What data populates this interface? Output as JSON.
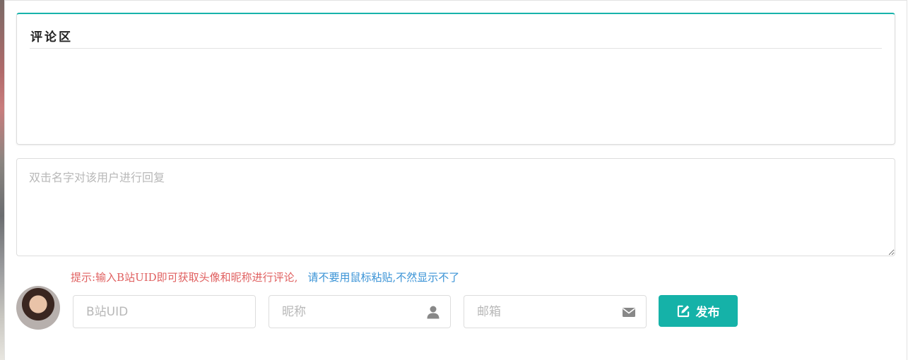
{
  "comment_panel": {
    "title": "评论区"
  },
  "reply_box": {
    "placeholder": "双击名字对该用户进行回复"
  },
  "hint": {
    "primary": "提示:输入B站UID即可获取头像和昵称进行评论,",
    "secondary": "请不要用鼠标粘贴,不然显示不了"
  },
  "form": {
    "uid_placeholder": "B站UID",
    "nickname_placeholder": "昵称",
    "email_placeholder": "邮箱",
    "submit_label": "发布"
  },
  "icons": {
    "nickname": "user-icon",
    "email": "envelope-icon",
    "submit": "edit-icon"
  },
  "colors": {
    "accent": "#15b2a8",
    "hint_red": "#e06060",
    "hint_blue": "#3a93d6"
  }
}
